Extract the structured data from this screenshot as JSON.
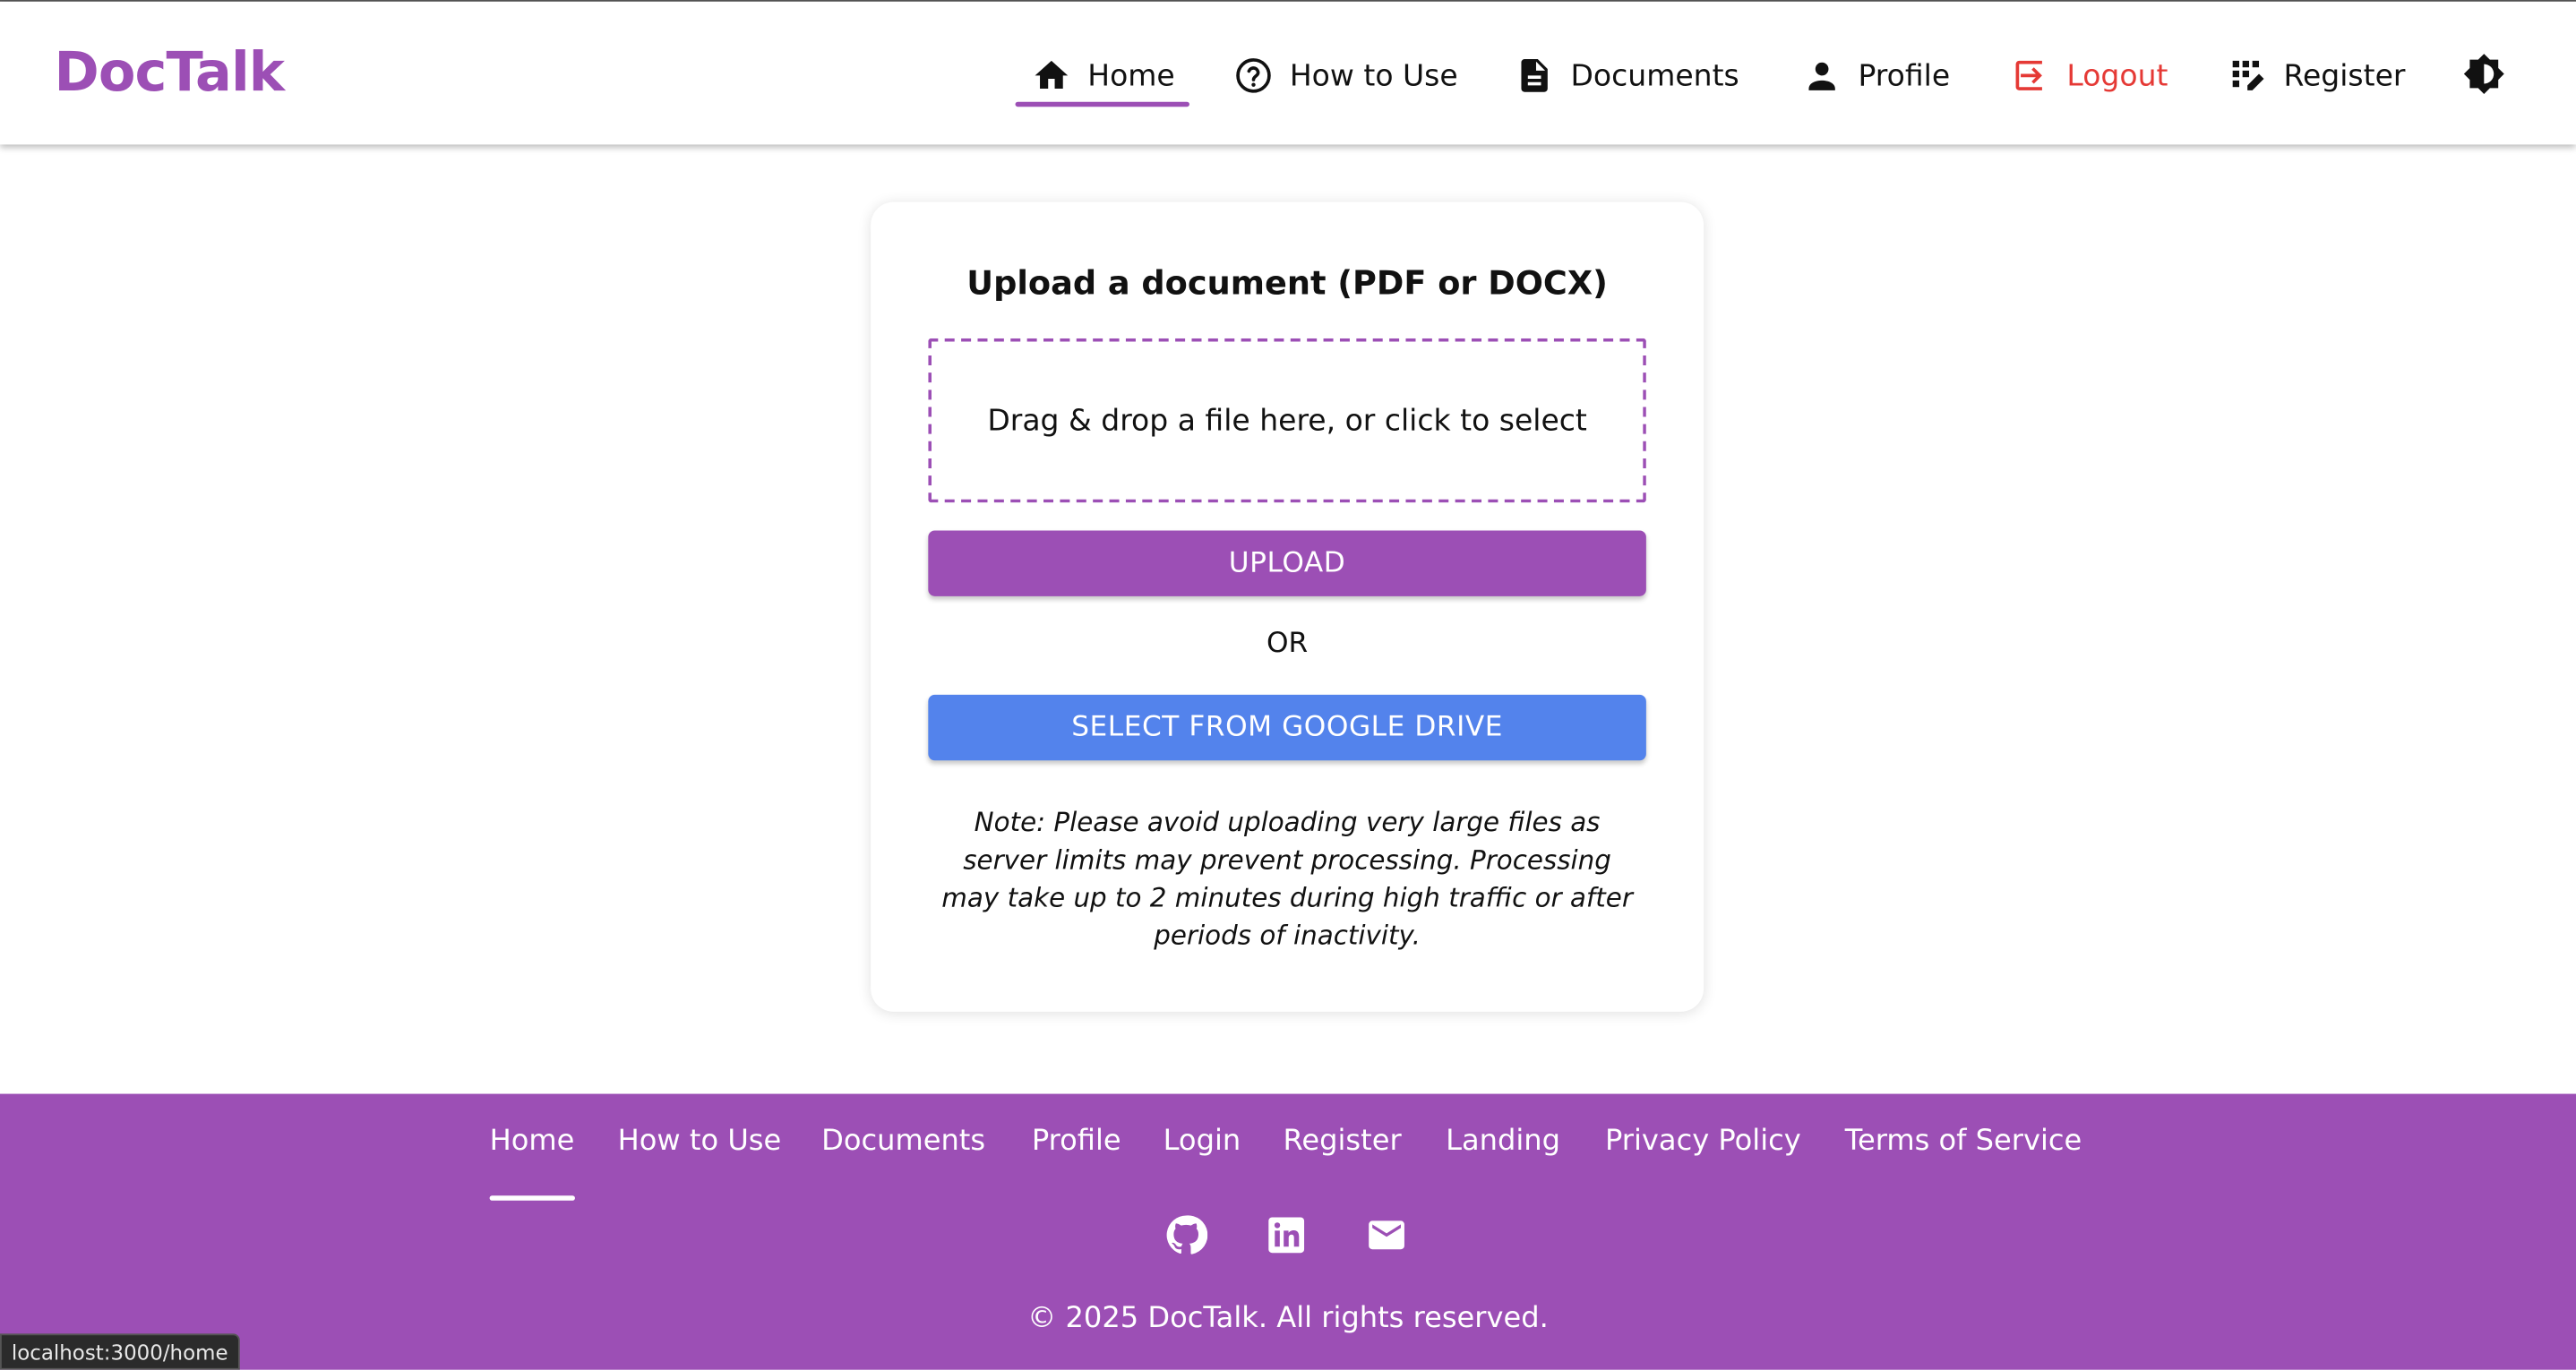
{
  "brand": {
    "name": "DocTalk",
    "color": "#9c4fb5"
  },
  "nav": {
    "items": [
      {
        "label": "Home",
        "icon": "home-icon",
        "active": true
      },
      {
        "label": "How to Use",
        "icon": "help-circle-icon"
      },
      {
        "label": "Documents",
        "icon": "document-icon"
      },
      {
        "label": "Profile",
        "icon": "person-icon"
      },
      {
        "label": "Logout",
        "icon": "logout-icon",
        "color": "#e53935"
      },
      {
        "label": "Register",
        "icon": "register-icon"
      }
    ],
    "theme_toggle_icon": "brightness-icon"
  },
  "upload": {
    "title": "Upload a document (PDF or DOCX)",
    "dropzone_text": "Drag & drop a file here, or click to select",
    "upload_label": "UPLOAD",
    "or_label": "OR",
    "drive_label": "SELECT FROM GOOGLE DRIVE",
    "drive_color": "#5383ec",
    "note": "Note: Please avoid uploading very large files as server limits may prevent processing. Processing may take up to 2 minutes during high traffic or after periods of inactivity."
  },
  "footer": {
    "links": [
      "Home",
      "How to Use",
      "Documents",
      "Profile",
      "Login",
      "Register",
      "Landing",
      "Privacy Policy",
      "Terms of Service"
    ],
    "active_link": "Home",
    "social_icons": [
      "github-icon",
      "linkedin-icon",
      "email-icon"
    ],
    "copyright": "© 2025 DocTalk. All rights reserved.",
    "background": "#9c4fb5"
  },
  "status_bar": {
    "url": "localhost:3000/home"
  }
}
